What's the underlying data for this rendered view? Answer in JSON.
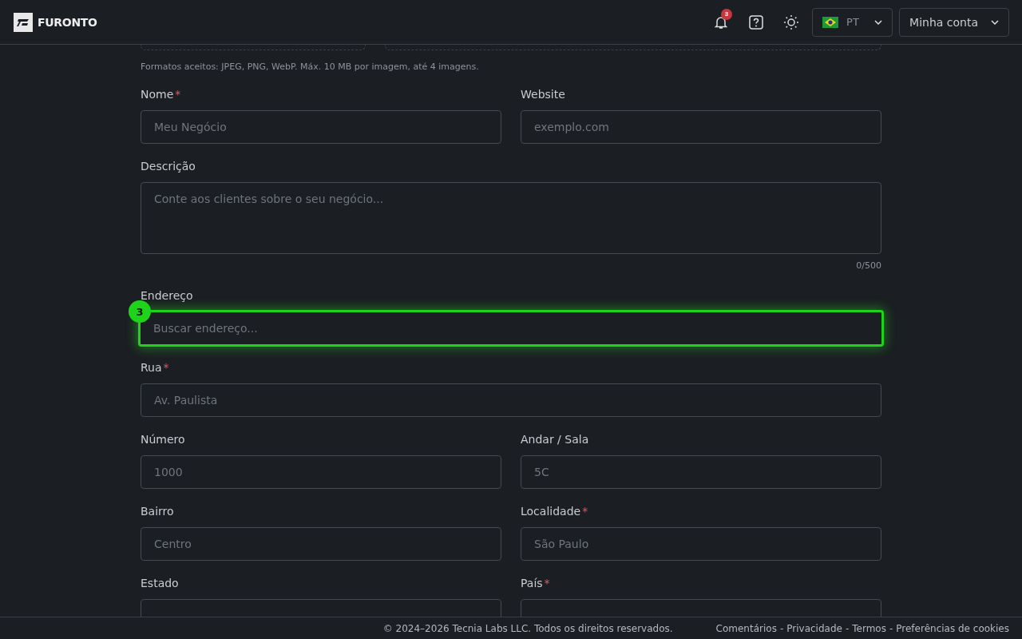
{
  "header": {
    "brand": "FURONTO",
    "notifications": {
      "count": "3"
    },
    "language": {
      "code": "PT"
    },
    "account": {
      "label": "Minha conta"
    }
  },
  "upload": {
    "hint": "Formatos aceitos: JPEG, PNG, WebP. Máx. 10 MB por imagem, até 4 imagens."
  },
  "rows": [
    [
      {
        "kind": "text",
        "label": "Nome",
        "required_mark": "*",
        "placeholder": "Meu Negócio"
      },
      {
        "kind": "text",
        "label": "Website",
        "placeholder": "exemplo.com"
      }
    ],
    [
      {
        "kind": "textarea",
        "label": "Descrição",
        "placeholder": "Conte aos clientes sobre o seu negócio...",
        "counter": "0/500"
      }
    ],
    [
      {
        "kind": "text",
        "label": "Endereço",
        "placeholder": "Buscar endereço...",
        "highlighted": true,
        "badge": "3"
      }
    ],
    [
      {
        "kind": "text",
        "label": "Rua",
        "required_mark": "*",
        "placeholder": "Av. Paulista"
      }
    ],
    [
      {
        "kind": "text",
        "label": "Número",
        "placeholder": "1000"
      },
      {
        "kind": "text",
        "label": "Andar / Sala",
        "placeholder": "5C"
      }
    ],
    [
      {
        "kind": "text",
        "label": "Bairro",
        "placeholder": "Centro"
      },
      {
        "kind": "text",
        "label": "Localidade",
        "required_mark": "*",
        "placeholder": "São Paulo"
      }
    ],
    [
      {
        "kind": "cut",
        "label": "Estado"
      },
      {
        "kind": "cut",
        "label": "País",
        "required_mark": "*"
      }
    ]
  ],
  "footer": {
    "copyright": "© 2024–2026 Tecnia Labs LLC. Todos os direitos reservados.",
    "links": [
      {
        "label": "Comentários"
      },
      {
        "separator": "-",
        "label": "Privacidade"
      },
      {
        "separator": "-",
        "label": "Termos"
      },
      {
        "separator": "-",
        "label": "Preferências de cookies"
      }
    ]
  }
}
